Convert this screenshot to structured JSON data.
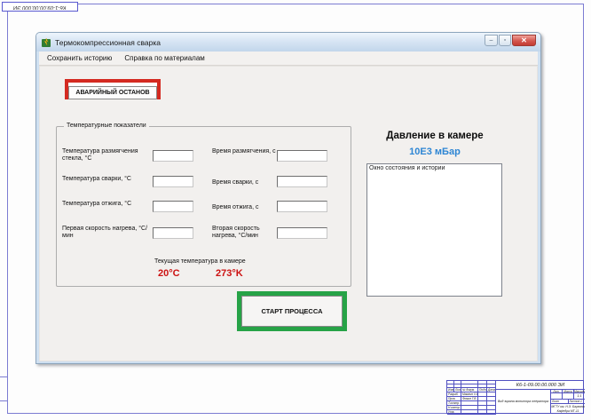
{
  "sheet": {
    "corner_designation": "К6-1-09.00.00.000 ЭИ",
    "title_block": {
      "designation": "К6-1-09.00.00.000 ЭИ",
      "doc_title": "Вид экрана монитора оператора",
      "header": {
        "izm": "Изм.",
        "list": "Лист",
        "doc": "№ докум.",
        "podp": "Подп.",
        "data": "Дата"
      },
      "sign_rows": [
        {
          "label": "Разраб.",
          "name": "Мамлин Х.В."
        },
        {
          "label": "Пров.",
          "name": "Фомин Г.В."
        },
        {
          "label": "Т.контр.",
          "name": ""
        },
        {
          "label": "Н.контр.",
          "name": ""
        },
        {
          "label": "Утв.",
          "name": ""
        }
      ],
      "lit_label": "Лит.",
      "mass_label": "Масса",
      "scale_label": "Масштаб",
      "scale_value": "1:1",
      "sheet_label": "Лист",
      "sheets_label": "Листов 1",
      "org_line1": "МГТУ им. Н.Э. Баумана",
      "org_line2": "Кафедра МТ-11"
    }
  },
  "window": {
    "title": "Термокомпрессионная сварка",
    "controls": {
      "minimize_glyph": "–",
      "maximize_glyph": "▫",
      "close_glyph": "✕"
    },
    "menu": [
      "Сохранить историю",
      "Справка по материалам"
    ],
    "emergency_stop_label": "АВАРИЙНЫЙ ОСТАНОВ",
    "group_title": "Температурные показатели",
    "rows": [
      {
        "label1": "Температура размягчения стекла, °С",
        "value1": "",
        "label2": "Время размягчения, с",
        "value2": ""
      },
      {
        "label1": "Температура сварки, °С",
        "value1": "",
        "label2": "Время сварки, с",
        "value2": ""
      },
      {
        "label1": "Температура отжига, °С",
        "value1": "",
        "label2": "Время отжига, с",
        "value2": ""
      },
      {
        "label1": "Первая скорость нагрева, °С/мин",
        "value1": "",
        "label2": "Вторая скорость нагрева, °С/мин",
        "value2": ""
      }
    ],
    "current_temp_label": "Текущая температура в камере",
    "current_temp_c": "20°C",
    "current_temp_k": "273°K",
    "start_label": "СТАРТ ПРОЦЕССА",
    "pressure_title": "Давление в камере",
    "pressure_value": "10Е3 мБар",
    "status_text": "Окно состояния и истории",
    "colors": {
      "emergency_red": "#d42a21",
      "start_green": "#27a347",
      "pressure_blue": "#2e86d4",
      "temp_red": "#cc1111"
    }
  }
}
